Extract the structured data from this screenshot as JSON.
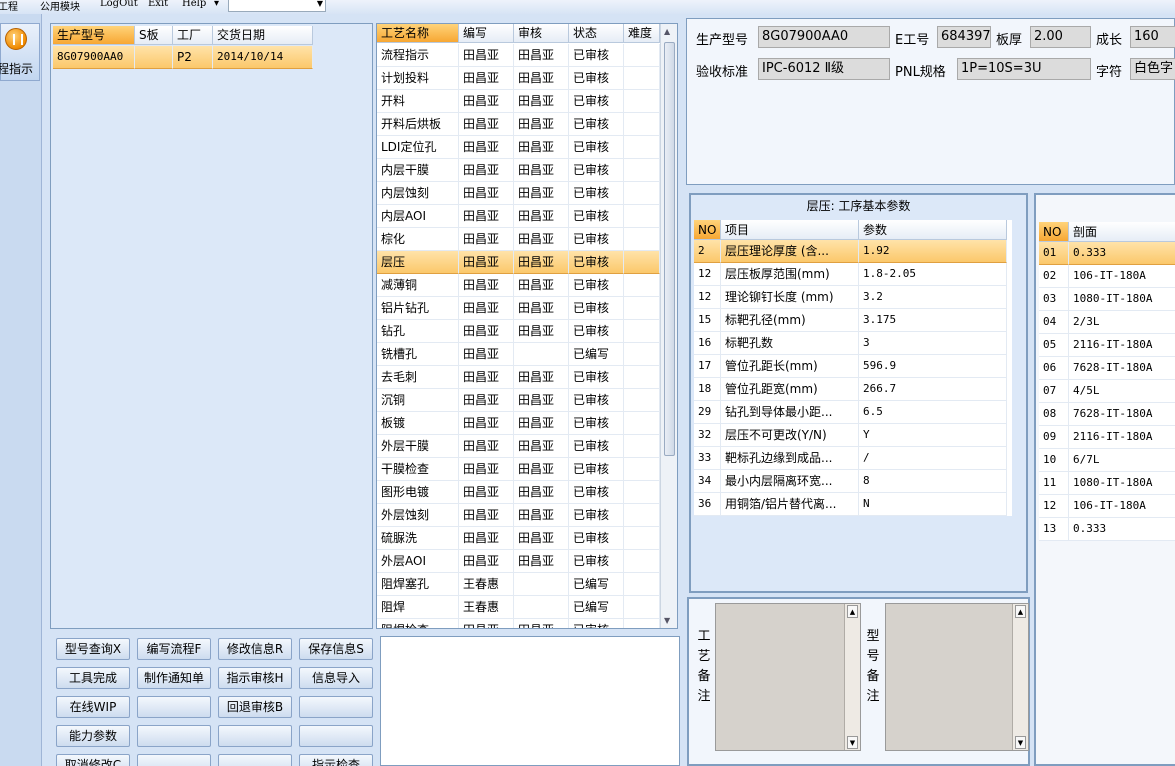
{
  "menu": {
    "items": [
      "工程",
      "公用模块",
      "LogOut",
      "Exit",
      "Help"
    ],
    "help_arrow": "▾"
  },
  "nav": {
    "label": "程指示"
  },
  "model_list": {
    "columns": [
      "生产型号",
      "S板",
      "工厂",
      "交货日期"
    ],
    "rows": [
      [
        "8G07900AA0",
        "",
        "P2",
        "2014/10/14"
      ]
    ]
  },
  "process_list": {
    "columns": [
      "工艺名称",
      "编写",
      "审核",
      "状态",
      "难度"
    ],
    "selected_index": 9,
    "rows": [
      [
        "流程指示",
        "田昌亚",
        "田昌亚",
        "已审核",
        ""
      ],
      [
        "计划投料",
        "田昌亚",
        "田昌亚",
        "已审核",
        ""
      ],
      [
        "开料",
        "田昌亚",
        "田昌亚",
        "已审核",
        ""
      ],
      [
        "开料后烘板",
        "田昌亚",
        "田昌亚",
        "已审核",
        ""
      ],
      [
        "LDI定位孔",
        "田昌亚",
        "田昌亚",
        "已审核",
        ""
      ],
      [
        "内层干膜",
        "田昌亚",
        "田昌亚",
        "已审核",
        ""
      ],
      [
        "内层蚀刻",
        "田昌亚",
        "田昌亚",
        "已审核",
        ""
      ],
      [
        "内层AOI",
        "田昌亚",
        "田昌亚",
        "已审核",
        ""
      ],
      [
        "棕化",
        "田昌亚",
        "田昌亚",
        "已审核",
        ""
      ],
      [
        "层压",
        "田昌亚",
        "田昌亚",
        "已审核",
        ""
      ],
      [
        "减薄铜",
        "田昌亚",
        "田昌亚",
        "已审核",
        ""
      ],
      [
        "铝片钻孔",
        "田昌亚",
        "田昌亚",
        "已审核",
        ""
      ],
      [
        "钻孔",
        "田昌亚",
        "田昌亚",
        "已审核",
        ""
      ],
      [
        "铣槽孔",
        "田昌亚",
        "",
        "已编写",
        ""
      ],
      [
        "去毛刺",
        "田昌亚",
        "田昌亚",
        "已审核",
        ""
      ],
      [
        "沉铜",
        "田昌亚",
        "田昌亚",
        "已审核",
        ""
      ],
      [
        "板镀",
        "田昌亚",
        "田昌亚",
        "已审核",
        ""
      ],
      [
        "外层干膜",
        "田昌亚",
        "田昌亚",
        "已审核",
        ""
      ],
      [
        "干膜检查",
        "田昌亚",
        "田昌亚",
        "已审核",
        ""
      ],
      [
        "图形电镀",
        "田昌亚",
        "田昌亚",
        "已审核",
        ""
      ],
      [
        "外层蚀刻",
        "田昌亚",
        "田昌亚",
        "已审核",
        ""
      ],
      [
        "硫脲洗",
        "田昌亚",
        "田昌亚",
        "已审核",
        ""
      ],
      [
        "外层AOI",
        "田昌亚",
        "田昌亚",
        "已审核",
        ""
      ],
      [
        "阻焊塞孔",
        "王春惠",
        "",
        "已编写",
        ""
      ],
      [
        "阻焊",
        "王春惠",
        "",
        "已编写",
        ""
      ],
      [
        "阻焊检查",
        "田昌亚",
        "田昌亚",
        "已审核",
        ""
      ]
    ]
  },
  "buttons": {
    "query_model": "型号查询X",
    "write_flow": "编写流程F",
    "modify_info": "修改信息R",
    "save_info": "保存信息S",
    "tool_done": "工具完成",
    "make_notice": "制作通知单",
    "review_instruction": "指示审核H",
    "import_info": "信息导入",
    "online_wip": "在线WIP",
    "blank1": "",
    "withdraw_review": "回退审核B",
    "blank2": "",
    "capability_params": "能力参数",
    "blank3": "",
    "blank4": "",
    "blank5": "",
    "cancel_modify": "取消修改C",
    "blank6": "",
    "blank7": "",
    "instruction_check": "指示检查"
  },
  "info": {
    "model_label": "生产型号",
    "model_value": "8G07900AA0",
    "eng_label": "E工号",
    "eng_value": "684397",
    "thickness_label": "板厚",
    "thickness_value": "2.00",
    "length_label": "成长",
    "length_value": "160",
    "standard_label": "验收标准",
    "standard_value": "IPC-6012 Ⅱ级",
    "pnl_label": "PNL规格",
    "pnl_value": "1P=10S=3U",
    "char_label": "字符",
    "char_value": "白色字"
  },
  "params": {
    "title": "层压: 工序基本参数",
    "columns": [
      "NO",
      "项目",
      "参数"
    ],
    "rows": [
      [
        "2",
        "层压理论厚度 (含...",
        "1.92"
      ],
      [
        "12",
        "层压板厚范围(mm)",
        "1.8-2.05"
      ],
      [
        "12",
        "理论铆钉长度 (mm)",
        "3.2"
      ],
      [
        "15",
        "标靶孔径(mm)",
        "3.175"
      ],
      [
        "16",
        "标靶孔数",
        "3"
      ],
      [
        "17",
        "管位孔距长(mm)",
        "596.9"
      ],
      [
        "18",
        "管位孔距宽(mm)",
        "266.7"
      ],
      [
        "29",
        "钻孔到导体最小距...",
        "6.5"
      ],
      [
        "32",
        "层压不可更改(Y/N)",
        "Y"
      ],
      [
        "33",
        "靶标孔边缘到成品...",
        "/"
      ],
      [
        "34",
        "最小内层隔离环宽...",
        "8"
      ],
      [
        "36",
        "用铜箔/铝片替代离...",
        "N"
      ]
    ]
  },
  "section": {
    "columns": [
      "NO",
      "剖面"
    ],
    "rows": [
      [
        "01",
        "0.333"
      ],
      [
        "02",
        "106-IT-180A"
      ],
      [
        "03",
        "1080-IT-180A"
      ],
      [
        "04",
        "2/3L"
      ],
      [
        "05",
        "2116-IT-180A"
      ],
      [
        "06",
        "7628-IT-180A"
      ],
      [
        "07",
        "4/5L"
      ],
      [
        "08",
        "7628-IT-180A"
      ],
      [
        "09",
        "2116-IT-180A"
      ],
      [
        "10",
        "6/7L"
      ],
      [
        "11",
        "1080-IT-180A"
      ],
      [
        "12",
        "106-IT-180A"
      ],
      [
        "13",
        "0.333"
      ]
    ]
  },
  "remarks": {
    "process_label": "工艺备注",
    "model_label": "型号备注",
    "process_text": "",
    "model_text": ""
  }
}
